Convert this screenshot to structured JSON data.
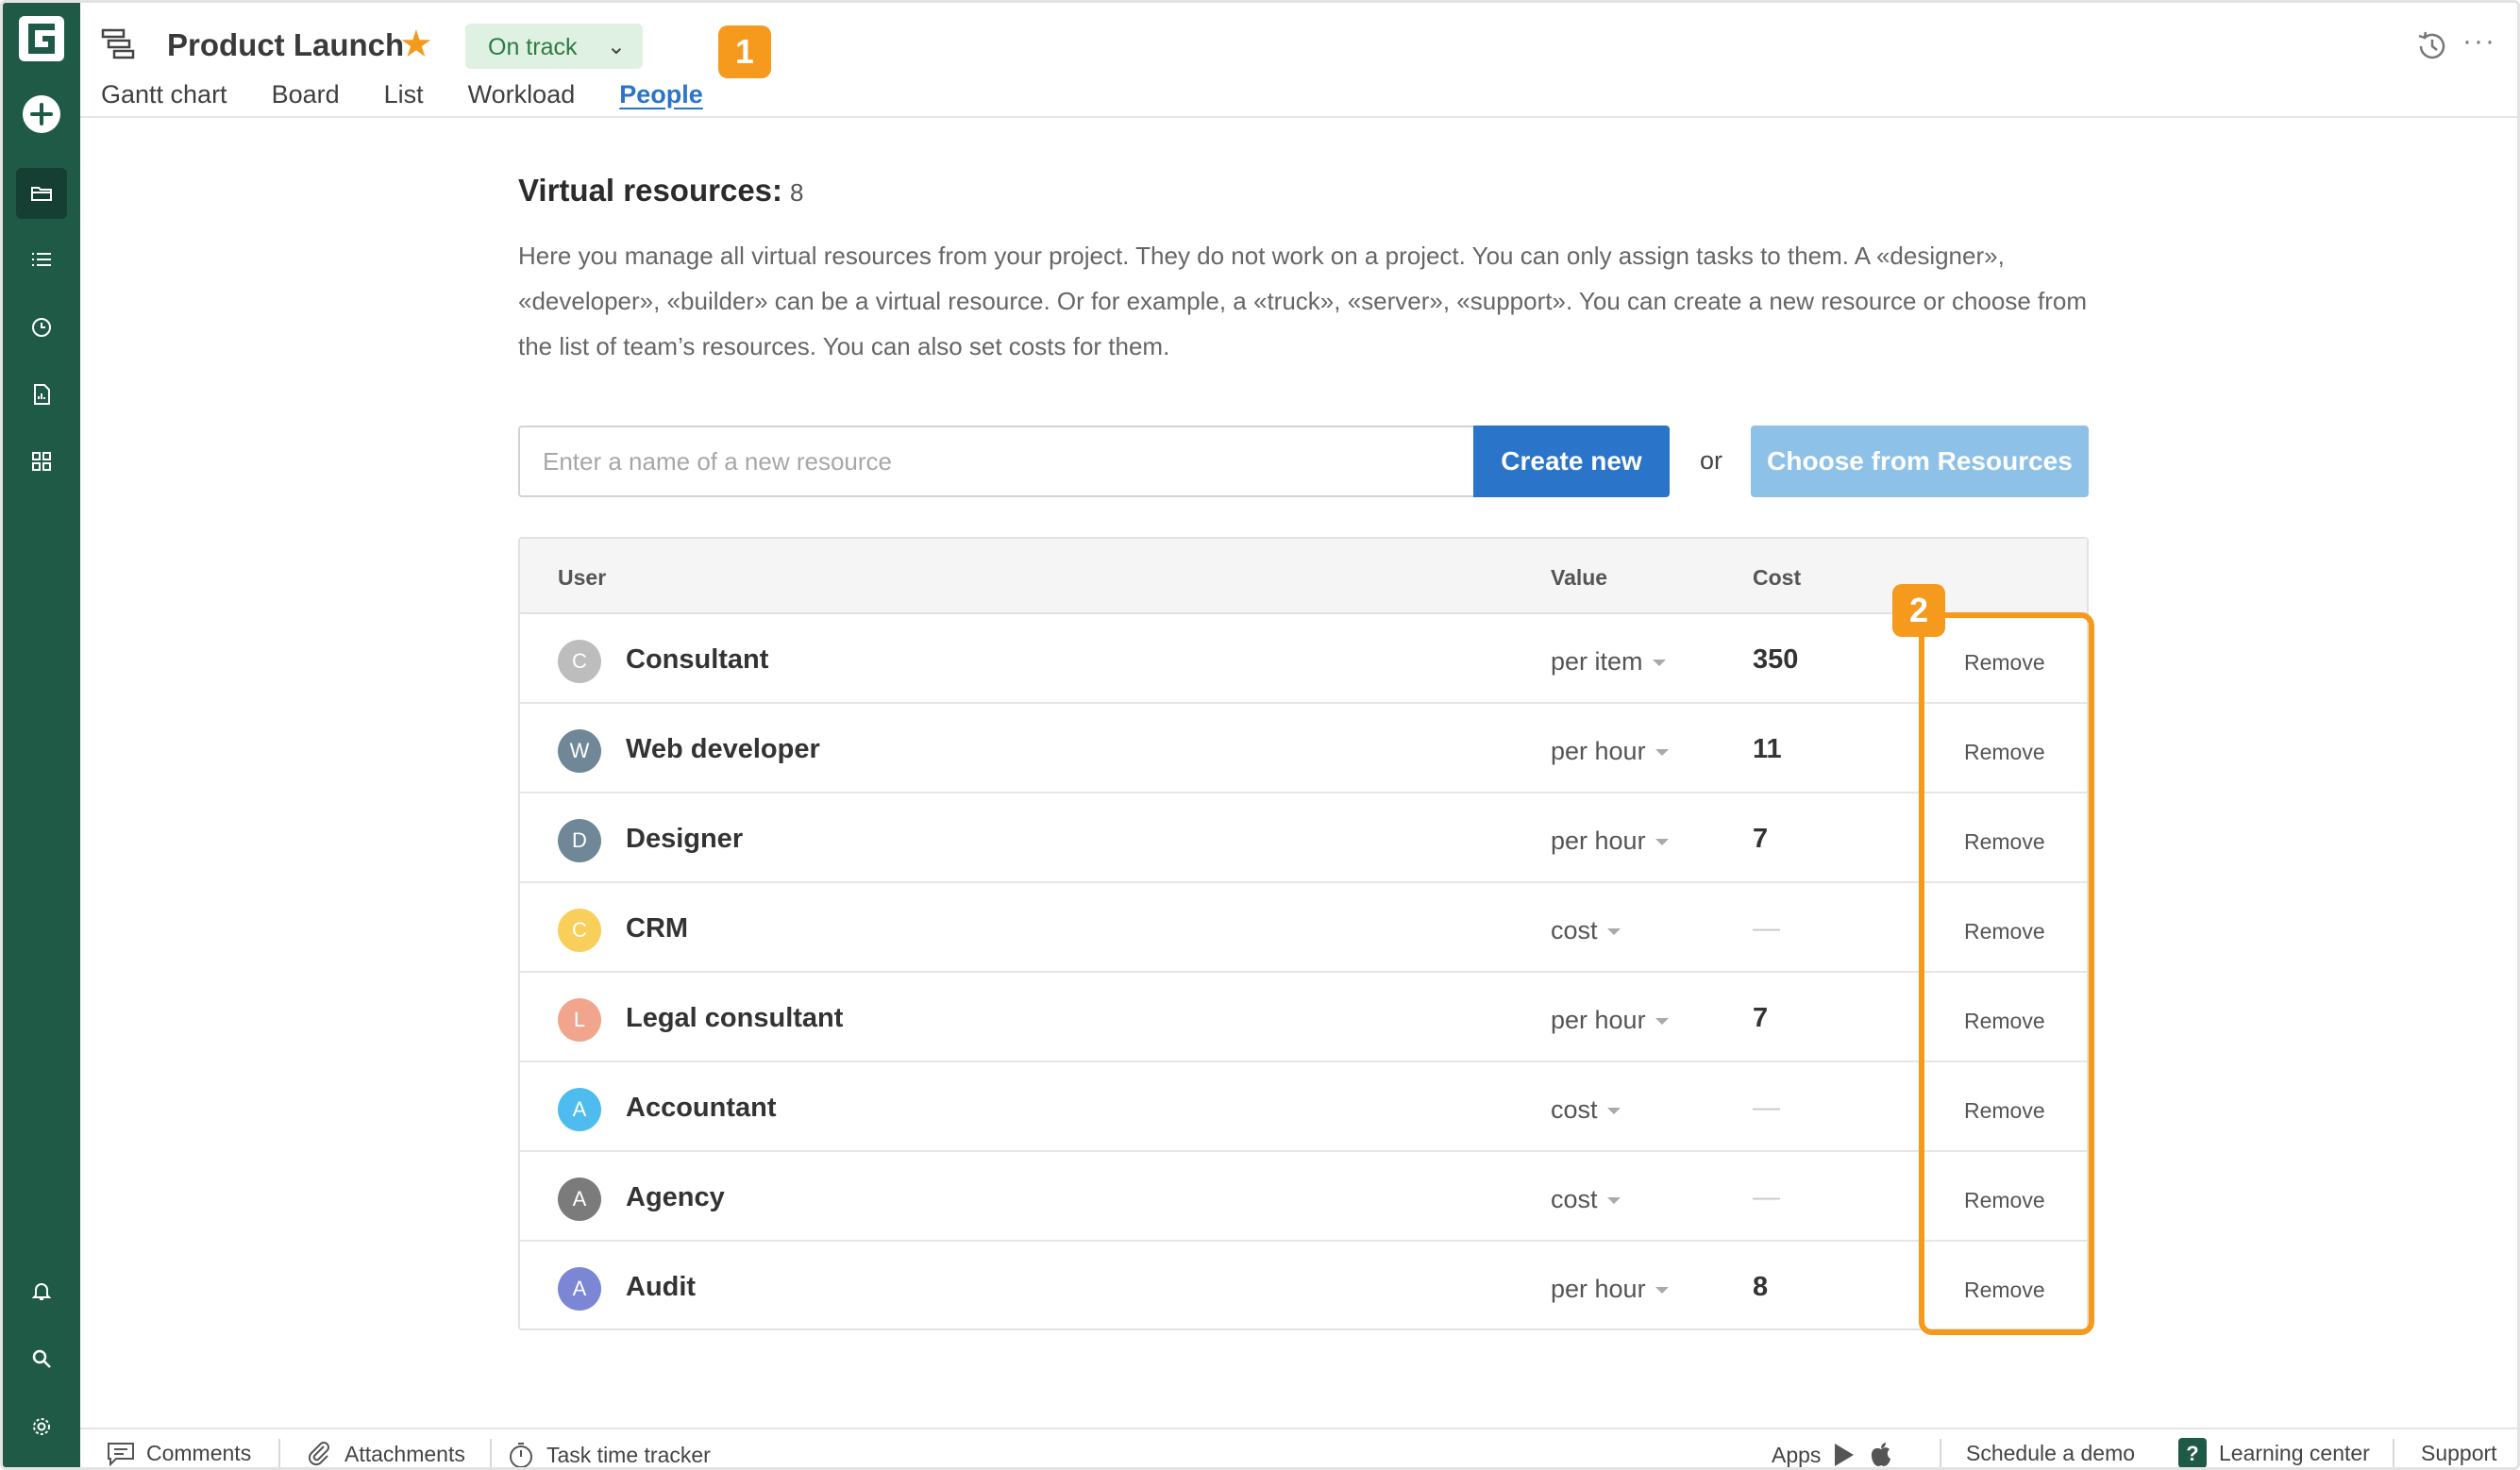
{
  "header": {
    "project_title": "Product Launch",
    "status": "On track",
    "annotation_badge": "1",
    "tabs": [
      {
        "label": "Gantt chart",
        "active": false
      },
      {
        "label": "Board",
        "active": false
      },
      {
        "label": "List",
        "active": false
      },
      {
        "label": "Workload",
        "active": false
      },
      {
        "label": "People",
        "active": true
      }
    ]
  },
  "section": {
    "title": "Virtual resources:",
    "count": "8",
    "description": "Here you manage all virtual resources from your project. They do not work on a project. You can only assign tasks to them. A «designer», «developer», «builder» can be a virtual resource. Or for example, a «truck», «server», «support». You can create a new resource or choose from the list of team’s resources. You can also set costs for them."
  },
  "create": {
    "placeholder": "Enter a name of a new resource",
    "create_label": "Create new",
    "or_label": "or",
    "choose_label": "Choose from Resources"
  },
  "table": {
    "headers": {
      "user": "User",
      "value": "Value",
      "cost": "Cost"
    },
    "annotation_badge": "2",
    "rows": [
      {
        "initial": "C",
        "name": "Consultant",
        "value": "per item",
        "cost": "350",
        "remove": "Remove",
        "color": "#bdbdbd"
      },
      {
        "initial": "W",
        "name": "Web developer",
        "value": "per hour",
        "cost": "11",
        "remove": "Remove",
        "color": "#6f8796"
      },
      {
        "initial": "D",
        "name": "Designer",
        "value": "per hour",
        "cost": "7",
        "remove": "Remove",
        "color": "#6f8796"
      },
      {
        "initial": "C",
        "name": "CRM",
        "value": "cost",
        "cost": "—",
        "remove": "Remove",
        "color": "#f9cf5c"
      },
      {
        "initial": "L",
        "name": "Legal consultant",
        "value": "per hour",
        "cost": "7",
        "remove": "Remove",
        "color": "#f0a58c"
      },
      {
        "initial": "A",
        "name": "Accountant",
        "value": "cost",
        "cost": "—",
        "remove": "Remove",
        "color": "#4fbcef"
      },
      {
        "initial": "A",
        "name": "Agency",
        "value": "cost",
        "cost": "—",
        "remove": "Remove",
        "color": "#7b7b7b"
      },
      {
        "initial": "A",
        "name": "Audit",
        "value": "per hour",
        "cost": "8",
        "remove": "Remove",
        "color": "#7b86d4"
      }
    ]
  },
  "footer": {
    "comments": "Comments",
    "attachments": "Attachments",
    "time_tracker": "Task time tracker",
    "apps": "Apps",
    "schedule_demo": "Schedule a demo",
    "learning_center": "Learning center",
    "support": "Support"
  },
  "colors": {
    "sidebar": "#1f5a47",
    "accent": "#2a74c9",
    "annotation": "#f59a1c",
    "status_bg": "#dff1e3"
  }
}
